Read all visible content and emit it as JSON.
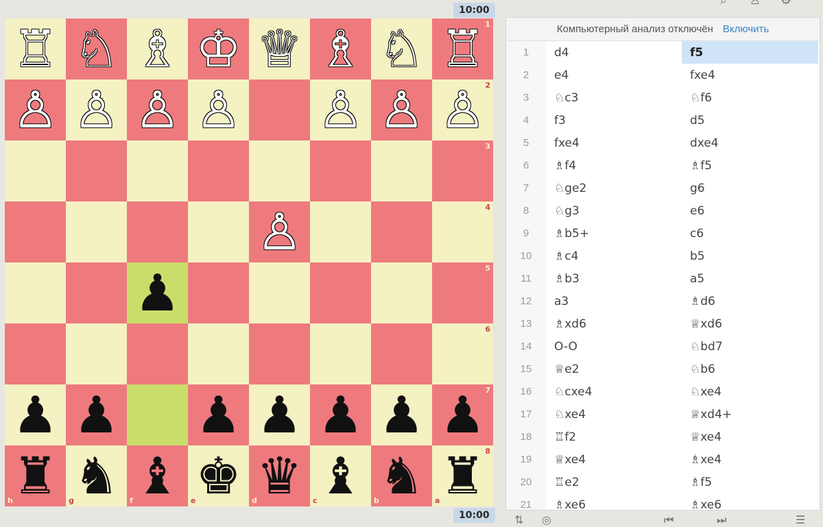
{
  "clocks": {
    "top": "10:00",
    "bottom": "10:00"
  },
  "board": {
    "colors": {
      "light": "#f4f1c2",
      "dark": "#ee7a7e",
      "highlight": "#c9de6a"
    },
    "rank_labels": [
      "1",
      "2",
      "3",
      "4",
      "5",
      "6",
      "7",
      "8"
    ],
    "file_labels": [
      "h",
      "g",
      "f",
      "e",
      "d",
      "c",
      "b",
      "a"
    ],
    "rows": [
      [
        "♖",
        "♘",
        "♗",
        "♔",
        "♕",
        "♗",
        "♘",
        "♖"
      ],
      [
        "♙",
        "♙",
        "♙",
        "♙",
        "",
        "♙",
        "♙",
        "♙"
      ],
      [
        "",
        "",
        "",
        "",
        "",
        "",
        "",
        ""
      ],
      [
        "",
        "",
        "",
        "",
        "♙",
        "",
        "",
        ""
      ],
      [
        "",
        "",
        "♟",
        "",
        "",
        "",
        "",
        ""
      ],
      [
        "",
        "",
        "",
        "",
        "",
        "",
        "",
        ""
      ],
      [
        "♟",
        "♟",
        "",
        "♟",
        "♟",
        "♟",
        "♟",
        "♟"
      ],
      [
        "♜",
        "♞",
        "♝",
        "♚",
        "♛",
        "♝",
        "♞",
        "♜"
      ]
    ],
    "piece_colors": [
      [
        "w",
        "w",
        "w",
        "w",
        "w",
        "w",
        "w",
        "w"
      ],
      [
        "w",
        "w",
        "w",
        "w",
        "",
        "w",
        "w",
        "w"
      ],
      [
        "",
        "",
        "",
        "",
        "",
        "",
        "",
        ""
      ],
      [
        "",
        "",
        "",
        "",
        "w",
        "",
        "",
        ""
      ],
      [
        "",
        "",
        "b",
        "",
        "",
        "",
        "",
        ""
      ],
      [
        "",
        "",
        "",
        "",
        "",
        "",
        "",
        ""
      ],
      [
        "b",
        "b",
        "",
        "b",
        "b",
        "b",
        "b",
        "b"
      ],
      [
        "b",
        "b",
        "b",
        "b",
        "b",
        "b",
        "b",
        "b"
      ]
    ],
    "highlighted": [
      [
        4,
        2
      ],
      [
        6,
        2
      ]
    ]
  },
  "analysis": {
    "status": "Компьютерный анализ отключён",
    "enable_label": "Включить"
  },
  "moves": [
    {
      "n": "1",
      "w": "d4",
      "b": "f5"
    },
    {
      "n": "2",
      "w": "e4",
      "b": "fxe4"
    },
    {
      "n": "3",
      "w": "♘c3",
      "b": "♘f6"
    },
    {
      "n": "4",
      "w": "f3",
      "b": "d5"
    },
    {
      "n": "5",
      "w": "fxe4",
      "b": "dxe4"
    },
    {
      "n": "6",
      "w": "♗f4",
      "b": "♗f5"
    },
    {
      "n": "7",
      "w": "♘ge2",
      "b": "g6"
    },
    {
      "n": "8",
      "w": "♘g3",
      "b": "e6"
    },
    {
      "n": "9",
      "w": "♗b5+",
      "b": "c6"
    },
    {
      "n": "10",
      "w": "♗c4",
      "b": "b5"
    },
    {
      "n": "11",
      "w": "♗b3",
      "b": "a5"
    },
    {
      "n": "12",
      "w": "a3",
      "b": "♗d6"
    },
    {
      "n": "13",
      "w": "♗xd6",
      "b": "♕xd6"
    },
    {
      "n": "14",
      "w": "O-O",
      "b": "♘bd7"
    },
    {
      "n": "15",
      "w": "♕e2",
      "b": "♘b6"
    },
    {
      "n": "16",
      "w": "♘cxe4",
      "b": "♘xe4"
    },
    {
      "n": "17",
      "w": "♘xe4",
      "b": "♕xd4+"
    },
    {
      "n": "18",
      "w": "♖f2",
      "b": "♕xe4"
    },
    {
      "n": "19",
      "w": "♕xe4",
      "b": "♗xe4"
    },
    {
      "n": "20",
      "w": "♖e2",
      "b": "♗f5"
    },
    {
      "n": "21",
      "w": "♗xe6",
      "b": "♗xe6"
    }
  ],
  "active_move": {
    "row": 0,
    "side": "b"
  },
  "icons": {
    "top_right": [
      "search-icon",
      "user-icon",
      "gear-icon"
    ]
  }
}
